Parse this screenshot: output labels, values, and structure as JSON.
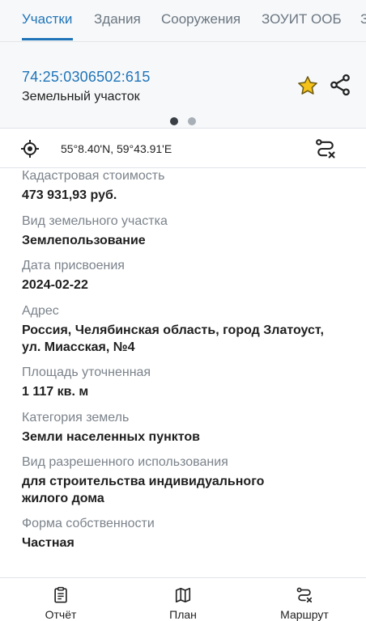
{
  "tabs": [
    "Участки",
    "Здания",
    "Сооружения",
    "ЗОУИТ ООБ",
    "З"
  ],
  "header": {
    "cadastral_number": "74:25:0306502:615",
    "object_type": "Земельный участок"
  },
  "coordinates": "55°8.40'N, 59°43.91'E",
  "details": [
    {
      "label": "Кадастровая стоимость",
      "value": "473 931,93 руб."
    },
    {
      "label": "Вид земельного участка",
      "value": "Землепользование"
    },
    {
      "label": "Дата присвоения",
      "value": "2024-02-22"
    },
    {
      "label": "Адрес",
      "value": "Россия, Челябинская область, город Златоуст, ул. Миасская, №4"
    },
    {
      "label": "Площадь уточненная",
      "value": "1 117 кв. м"
    },
    {
      "label": "Категория земель",
      "value": "Земли населенных пунктов"
    },
    {
      "label": "Вид разрешенного использования",
      "value": "для строительства индивидуального жилого дома"
    },
    {
      "label": "Форма собственности",
      "value": "Частная"
    }
  ],
  "bottom_nav": {
    "report": "Отчёт",
    "plan": "План",
    "route": "Маршрут"
  },
  "colors": {
    "accent": "#1f74b8",
    "star": "#f4c21a"
  }
}
